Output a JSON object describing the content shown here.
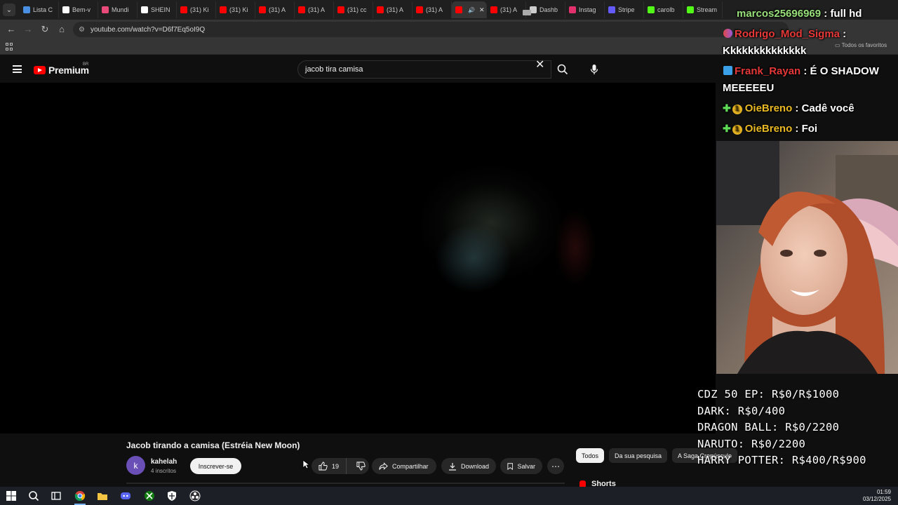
{
  "browser": {
    "tabs": [
      {
        "label": "Lista C",
        "icon": "cloud-icon",
        "color": "#4a90e2"
      },
      {
        "label": "Bem-v",
        "icon": "notion-icon",
        "color": "#ffffff"
      },
      {
        "label": "Mundi",
        "icon": "pin-icon",
        "color": "#e84a7a"
      },
      {
        "label": "SHEIN",
        "icon": "shein-icon",
        "color": "#ffffff"
      },
      {
        "label": "(31) Ki",
        "icon": "youtube-icon",
        "color": "#ff0000"
      },
      {
        "label": "(31) Ki",
        "icon": "youtube-icon",
        "color": "#ff0000"
      },
      {
        "label": "(31) A",
        "icon": "youtube-icon",
        "color": "#ff0000"
      },
      {
        "label": "(31) A",
        "icon": "youtube-icon",
        "color": "#ff0000"
      },
      {
        "label": "(31) cc",
        "icon": "youtube-icon",
        "color": "#ff0000"
      },
      {
        "label": "(31) A",
        "icon": "youtube-icon",
        "color": "#ff0000"
      },
      {
        "label": "(31) A",
        "icon": "youtube-icon",
        "color": "#ff0000"
      },
      {
        "label": "",
        "icon": "youtube-icon",
        "color": "#ff0000",
        "active": true
      },
      {
        "label": "(31) A",
        "icon": "youtube-icon",
        "color": "#ff0000"
      },
      {
        "label": "Dashb",
        "icon": "globe-icon",
        "color": "#cccccc"
      },
      {
        "label": "Instag",
        "icon": "instagram-icon",
        "color": "#e1306c"
      },
      {
        "label": "Stripe",
        "icon": "stripe-icon",
        "color": "#635bff"
      },
      {
        "label": "carolb",
        "icon": "kick-icon",
        "color": "#53fc18"
      },
      {
        "label": "Stream",
        "icon": "kick-icon",
        "color": "#53fc18"
      }
    ],
    "url": "youtube.com/watch?v=D6f7Eq5oI9Q",
    "bookmarks_folder": "Todos os favoritos"
  },
  "youtube": {
    "logo_text": "Premium",
    "country": "BR",
    "search_query": "jacob tira camisa",
    "video_title": "Jacob tirando a camisa (Estréia New Moon)",
    "channel": {
      "avatar_letter": "k",
      "name": "kahelah",
      "subscribers": "4 inscritos",
      "subscribe_label": "Inscrever-se"
    },
    "actions": {
      "likes": "19",
      "share": "Compartilhar",
      "download": "Download",
      "save": "Salvar"
    },
    "chips": [
      "Todos",
      "Da sua pesquisa",
      "A Saga Crepúsculo"
    ],
    "shorts_label": "Shorts"
  },
  "stream_overlay": {
    "chat": [
      {
        "user": "marcos25696969",
        "message": " : full hd"
      },
      {
        "user": "Rodrigo_Mod_Sigma",
        "message": " :"
      },
      {
        "user": "",
        "message": "Kkkkkkkkkkkkkk"
      },
      {
        "user": "Frank_Rayan",
        "message": " : É O SHADOW"
      },
      {
        "user": "",
        "message": "MEEEEEU"
      },
      {
        "user": "OieBreno",
        "message": " : Cadê você",
        "badge": "1"
      },
      {
        "user": "OieBreno",
        "message": " : Foi",
        "badge": "1"
      }
    ],
    "goals": [
      "CDZ 50 EP: R$0/R$1000",
      "DARK: R$0/400",
      "DRAGON BALL: R$0/2200",
      "NARUTO: R$0/2200",
      "HARRY POTTER: R$400/R$900"
    ]
  },
  "taskbar": {
    "time": "01:59",
    "date": "03/12/2025"
  }
}
